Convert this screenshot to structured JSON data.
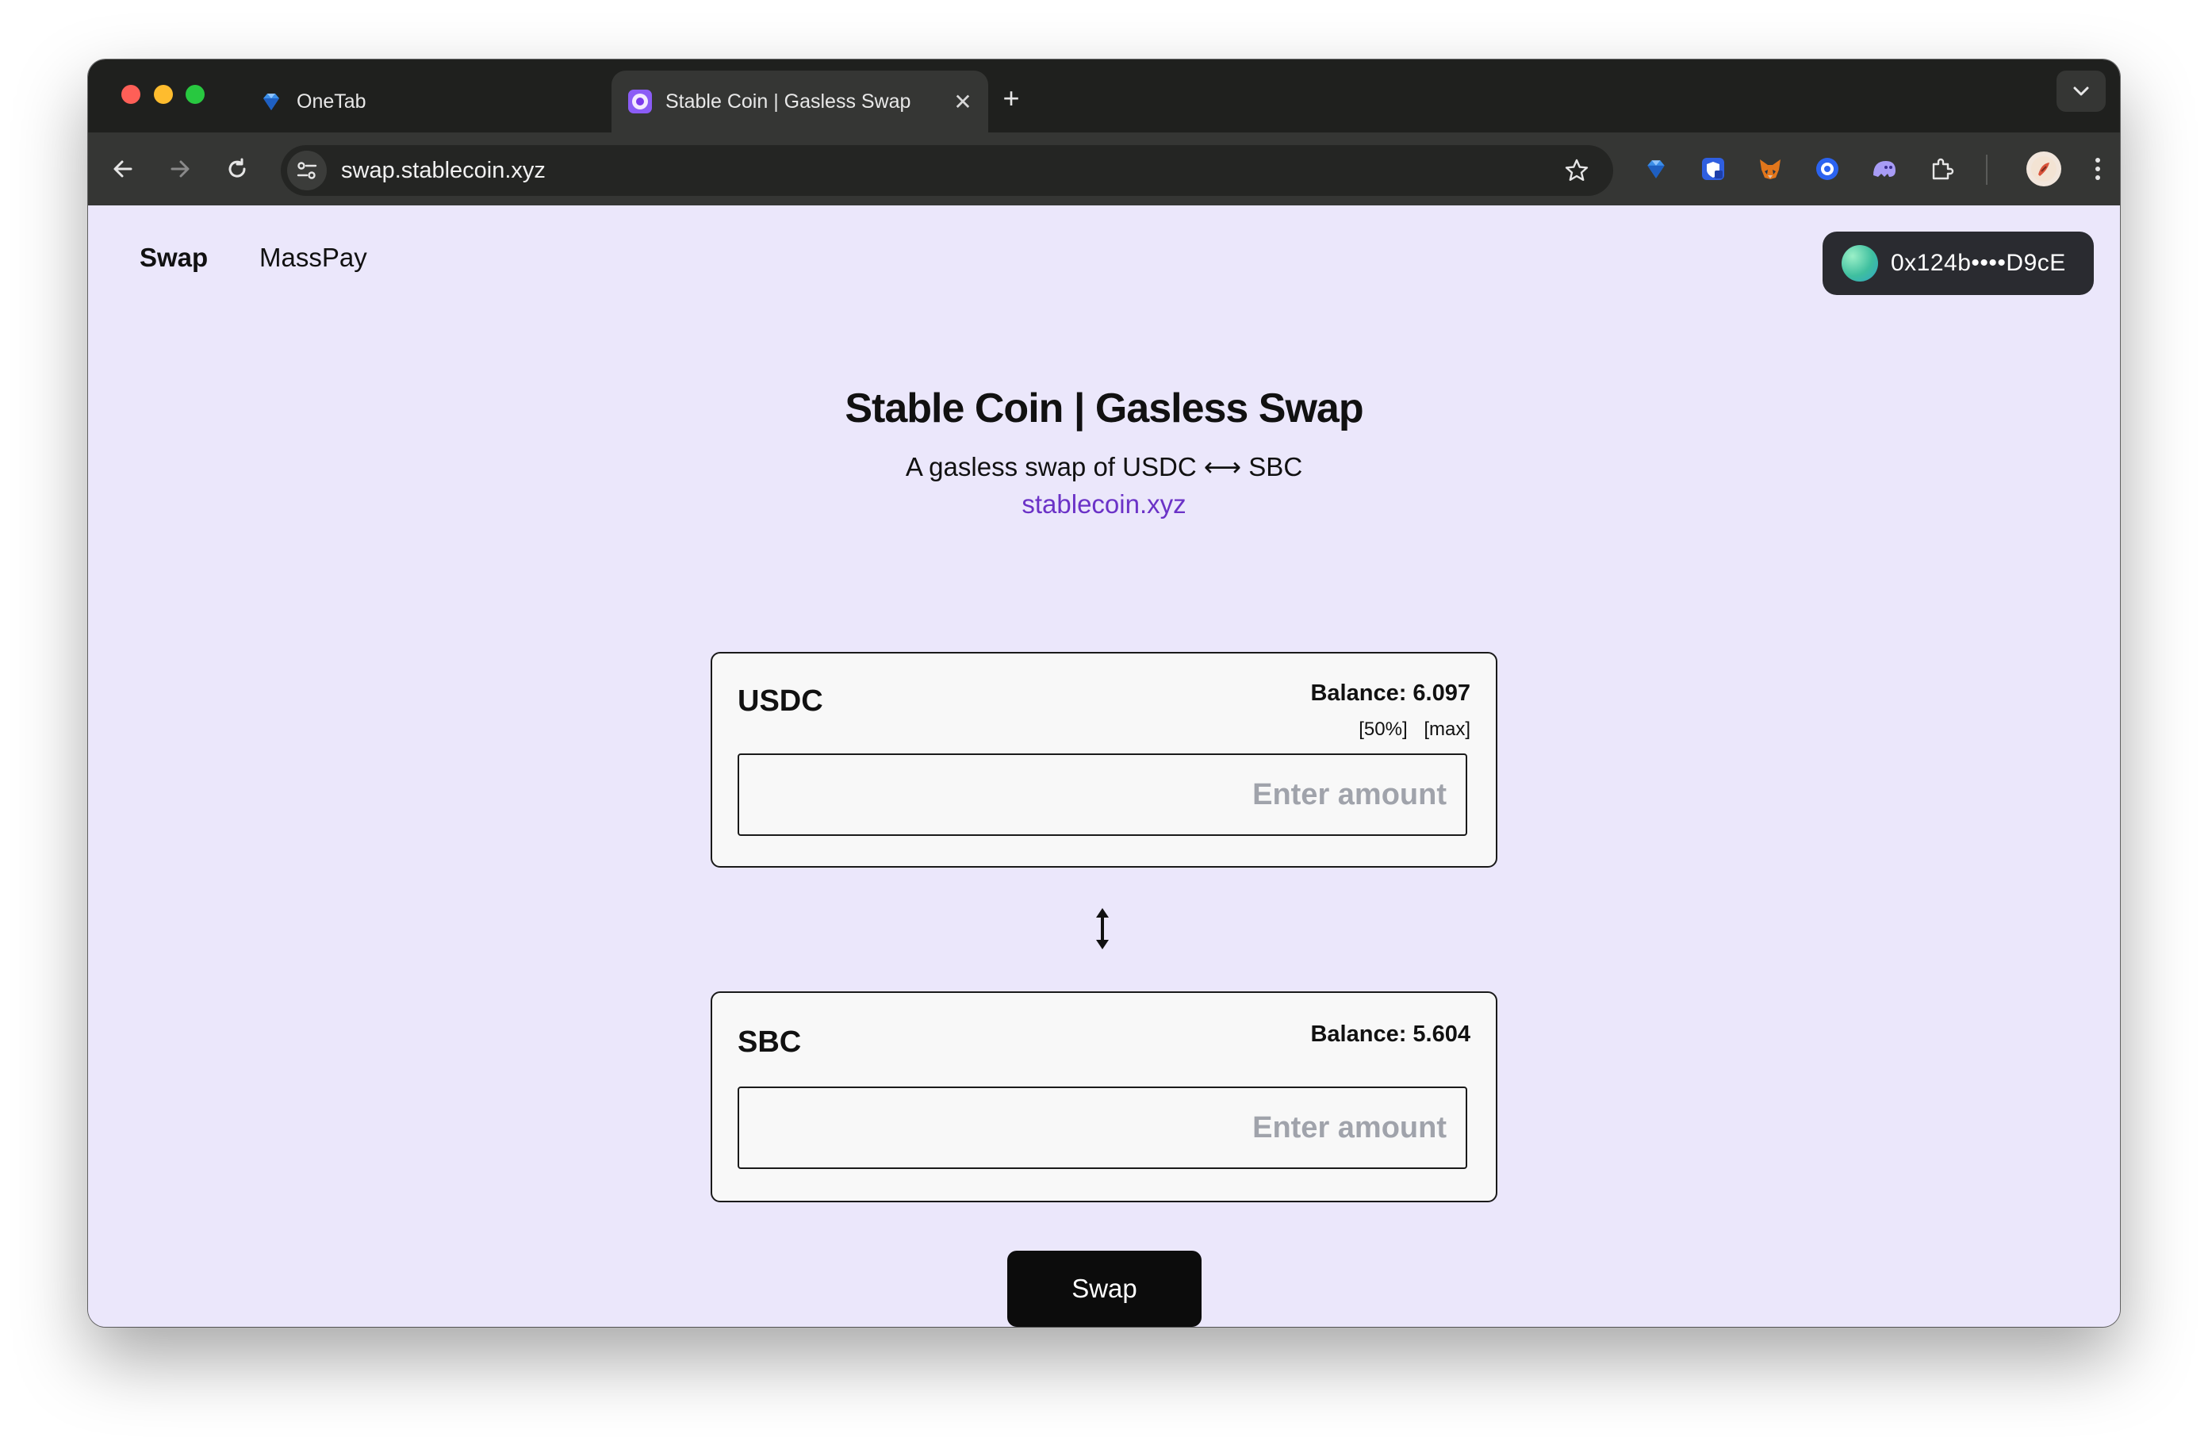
{
  "browser": {
    "tabs": [
      {
        "title": "OneTab",
        "favicon": "diamond-icon",
        "active": false
      },
      {
        "title": "Stable Coin | Gasless Swap",
        "favicon": "stablecoin-logo-icon",
        "active": true
      }
    ],
    "url": "swap.stablecoin.xyz",
    "extensions": [
      "diamond-extension-icon",
      "shield-extension-icon",
      "metamask-fox-icon",
      "circle-target-extension-icon",
      "ghost-extension-icon",
      "puzzle-extensions-icon"
    ]
  },
  "nav": {
    "swap_label": "Swap",
    "masspay_label": "MassPay"
  },
  "wallet": {
    "address": "0x124b••••D9cE"
  },
  "header": {
    "title": "Stable Coin | Gasless Swap",
    "subtitle": "A gasless swap of USDC ⟷ SBC",
    "link": "stablecoin.xyz"
  },
  "from": {
    "token": "USDC",
    "balance": "Balance: 6.097",
    "half_label": "[50%]",
    "max_label": "[max]",
    "placeholder": "Enter amount",
    "value": ""
  },
  "to": {
    "token": "SBC",
    "balance": "Balance: 5.604",
    "placeholder": "Enter amount",
    "value": ""
  },
  "actions": {
    "swap_label": "Swap"
  },
  "colors": {
    "page_bg": "#ebe7fb",
    "link": "#6b32c7",
    "button_bg": "#0c0c0c",
    "wallet_bg": "#2a2b30"
  }
}
